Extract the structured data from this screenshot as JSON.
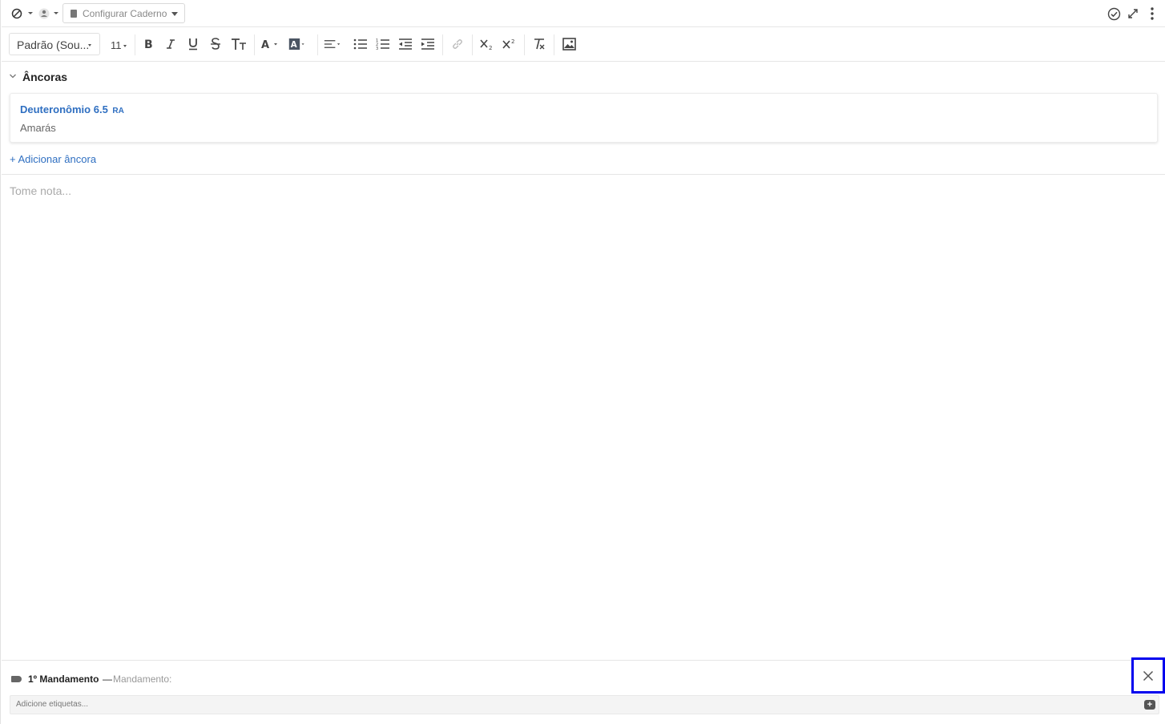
{
  "topbar": {
    "notebook_label": "Configurar Caderno"
  },
  "format_toolbar": {
    "font_family": "Padrão (Sou...",
    "font_size": "11"
  },
  "anchors": {
    "section_title": "Âncoras",
    "items": [
      {
        "reference": "Deuteronômio 6.5",
        "version": "RA",
        "subtitle": "Amarás"
      }
    ],
    "add_label": "+ Adicionar âncora"
  },
  "note": {
    "placeholder": "Tome nota..."
  },
  "footer": {
    "tag_name": "1º Mandamento",
    "tag_separator": "—",
    "tag_type": "Mandamento:",
    "tags_placeholder": "Adicione etiquetas..."
  },
  "colors": {
    "link": "#2f6fc1",
    "highlight_border": "#0000ee"
  }
}
